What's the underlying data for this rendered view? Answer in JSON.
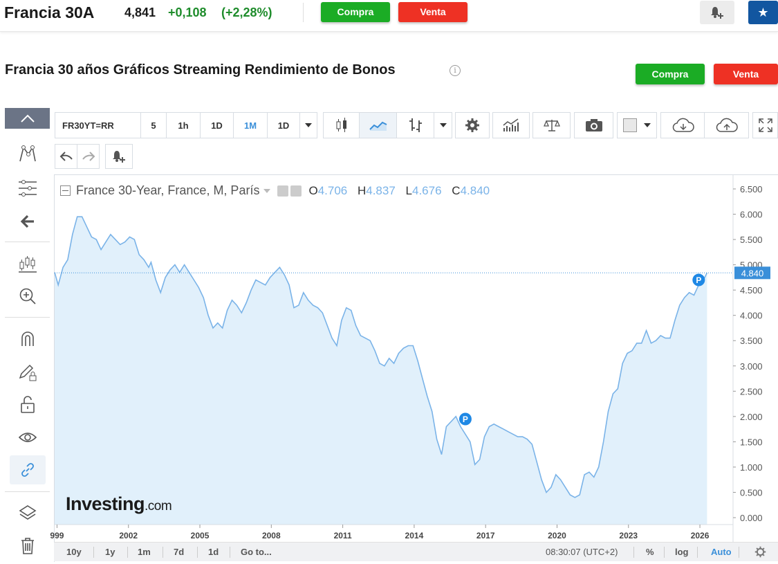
{
  "header": {
    "instrument": "Francia 30A",
    "price": "4,841",
    "change": "+0,108",
    "change_pct": "(+2,28%)",
    "buy_label": "Compra",
    "sell_label": "Venta"
  },
  "page": {
    "title": "Francia 30 años Gráficos Streaming Rendimiento de Bonos",
    "info_icon": "i",
    "buy_label": "Compra",
    "sell_label": "Venta"
  },
  "toolbar": {
    "symbol": "FR30YT=RR",
    "intervals": [
      "5",
      "1h",
      "1D",
      "1M",
      "1D"
    ],
    "active_interval": "1M"
  },
  "chart": {
    "legend_title": "France 30-Year, France, M, París",
    "ohlc": {
      "o_label": "O",
      "o": "4.706",
      "h_label": "H",
      "h": "4.837",
      "l_label": "L",
      "l": "4.676",
      "c_label": "C",
      "c": "4.840"
    },
    "watermark_main": "Investing",
    "watermark_suffix": ".com",
    "last_value_label": "4.840",
    "pivot_marker": "P"
  },
  "chart_data": {
    "type": "area",
    "title": "France 30-Year, France, M, París",
    "x_ticks": [
      "999",
      "2002",
      "2005",
      "2008",
      "2011",
      "2014",
      "2017",
      "2020",
      "2023",
      "2026"
    ],
    "y_ticks": [
      "0.000",
      "0.500",
      "1.000",
      "1.500",
      "2.000",
      "2.500",
      "3.000",
      "3.500",
      "4.000",
      "4.500",
      "5.000",
      "5.500",
      "6.000",
      "6.500"
    ],
    "ylim": [
      0,
      6.5
    ],
    "xlim": [
      1998.95,
      2026.6
    ],
    "last_value": 4.84,
    "series": [
      {
        "values": [
          [
            1998.95,
            4.85
          ],
          [
            1999.1,
            4.6
          ],
          [
            1999.3,
            4.95
          ],
          [
            1999.5,
            5.1
          ],
          [
            1999.7,
            5.6
          ],
          [
            1999.9,
            5.95
          ],
          [
            2000.1,
            5.95
          ],
          [
            2000.3,
            5.75
          ],
          [
            2000.5,
            5.55
          ],
          [
            2000.7,
            5.5
          ],
          [
            2000.9,
            5.3
          ],
          [
            2001.1,
            5.45
          ],
          [
            2001.3,
            5.6
          ],
          [
            2001.5,
            5.5
          ],
          [
            2001.7,
            5.4
          ],
          [
            2001.9,
            5.45
          ],
          [
            2002.1,
            5.55
          ],
          [
            2002.3,
            5.5
          ],
          [
            2002.5,
            5.2
          ],
          [
            2002.7,
            5.1
          ],
          [
            2002.9,
            4.95
          ],
          [
            2003.0,
            5.05
          ],
          [
            2003.2,
            4.7
          ],
          [
            2003.4,
            4.45
          ],
          [
            2003.6,
            4.75
          ],
          [
            2003.8,
            4.9
          ],
          [
            2004.0,
            5.0
          ],
          [
            2004.2,
            4.85
          ],
          [
            2004.4,
            5.0
          ],
          [
            2004.6,
            4.85
          ],
          [
            2004.8,
            4.7
          ],
          [
            2005.0,
            4.55
          ],
          [
            2005.2,
            4.35
          ],
          [
            2005.4,
            4.0
          ],
          [
            2005.6,
            3.75
          ],
          [
            2005.8,
            3.85
          ],
          [
            2006.0,
            3.75
          ],
          [
            2006.2,
            4.1
          ],
          [
            2006.4,
            4.3
          ],
          [
            2006.6,
            4.2
          ],
          [
            2006.8,
            4.05
          ],
          [
            2007.0,
            4.25
          ],
          [
            2007.2,
            4.5
          ],
          [
            2007.4,
            4.7
          ],
          [
            2007.6,
            4.65
          ],
          [
            2007.8,
            4.6
          ],
          [
            2008.0,
            4.75
          ],
          [
            2008.2,
            4.85
          ],
          [
            2008.4,
            4.95
          ],
          [
            2008.6,
            4.8
          ],
          [
            2008.8,
            4.6
          ],
          [
            2009.0,
            4.15
          ],
          [
            2009.2,
            4.2
          ],
          [
            2009.4,
            4.45
          ],
          [
            2009.6,
            4.3
          ],
          [
            2009.8,
            4.2
          ],
          [
            2010.0,
            4.15
          ],
          [
            2010.2,
            4.05
          ],
          [
            2010.4,
            3.8
          ],
          [
            2010.6,
            3.55
          ],
          [
            2010.8,
            3.4
          ],
          [
            2011.0,
            3.9
          ],
          [
            2011.2,
            4.15
          ],
          [
            2011.4,
            4.1
          ],
          [
            2011.6,
            3.8
          ],
          [
            2011.8,
            3.6
          ],
          [
            2012.0,
            3.55
          ],
          [
            2012.2,
            3.5
          ],
          [
            2012.4,
            3.3
          ],
          [
            2012.6,
            3.05
          ],
          [
            2012.8,
            3.0
          ],
          [
            2013.0,
            3.15
          ],
          [
            2013.2,
            3.05
          ],
          [
            2013.4,
            3.25
          ],
          [
            2013.6,
            3.35
          ],
          [
            2013.8,
            3.4
          ],
          [
            2014.0,
            3.4
          ],
          [
            2014.2,
            3.1
          ],
          [
            2014.4,
            2.75
          ],
          [
            2014.6,
            2.4
          ],
          [
            2014.8,
            2.1
          ],
          [
            2015.0,
            1.55
          ],
          [
            2015.2,
            1.25
          ],
          [
            2015.4,
            1.8
          ],
          [
            2015.6,
            1.9
          ],
          [
            2015.8,
            2.0
          ],
          [
            2016.0,
            1.8
          ],
          [
            2016.2,
            1.65
          ],
          [
            2016.4,
            1.5
          ],
          [
            2016.6,
            1.05
          ],
          [
            2016.8,
            1.15
          ],
          [
            2017.0,
            1.6
          ],
          [
            2017.2,
            1.8
          ],
          [
            2017.4,
            1.85
          ],
          [
            2017.6,
            1.8
          ],
          [
            2017.8,
            1.75
          ],
          [
            2018.0,
            1.7
          ],
          [
            2018.2,
            1.65
          ],
          [
            2018.4,
            1.6
          ],
          [
            2018.6,
            1.6
          ],
          [
            2018.8,
            1.55
          ],
          [
            2019.0,
            1.45
          ],
          [
            2019.2,
            1.1
          ],
          [
            2019.4,
            0.75
          ],
          [
            2019.6,
            0.5
          ],
          [
            2019.8,
            0.6
          ],
          [
            2020.0,
            0.85
          ],
          [
            2020.2,
            0.75
          ],
          [
            2020.4,
            0.6
          ],
          [
            2020.6,
            0.45
          ],
          [
            2020.8,
            0.4
          ],
          [
            2021.0,
            0.45
          ],
          [
            2021.2,
            0.85
          ],
          [
            2021.4,
            0.9
          ],
          [
            2021.6,
            0.8
          ],
          [
            2021.8,
            1.0
          ],
          [
            2022.0,
            1.5
          ],
          [
            2022.2,
            2.1
          ],
          [
            2022.4,
            2.45
          ],
          [
            2022.6,
            2.55
          ],
          [
            2022.8,
            3.05
          ],
          [
            2023.0,
            3.25
          ],
          [
            2023.2,
            3.3
          ],
          [
            2023.4,
            3.45
          ],
          [
            2023.6,
            3.45
          ],
          [
            2023.8,
            3.7
          ],
          [
            2024.0,
            3.45
          ],
          [
            2024.2,
            3.5
          ],
          [
            2024.4,
            3.6
          ],
          [
            2024.6,
            3.55
          ],
          [
            2024.8,
            3.55
          ],
          [
            2025.0,
            3.9
          ],
          [
            2025.2,
            4.2
          ],
          [
            2025.4,
            4.35
          ],
          [
            2025.6,
            4.45
          ],
          [
            2025.8,
            4.4
          ],
          [
            2026.0,
            4.6
          ],
          [
            2026.2,
            4.7
          ],
          [
            2026.35,
            4.84
          ]
        ]
      }
    ],
    "pivot_points": [
      [
        2016.2,
        1.95
      ],
      [
        2026.0,
        4.7
      ]
    ],
    "color_line": "#7ab3e8",
    "color_fill": "#e1f0fb",
    "grid": false
  },
  "bottom": {
    "ranges": [
      "10y",
      "1y",
      "1m",
      "7d",
      "1d"
    ],
    "goto": "Go to...",
    "time": "08:30:07 (UTC+2)",
    "pct": "%",
    "log": "log",
    "auto": "Auto"
  }
}
